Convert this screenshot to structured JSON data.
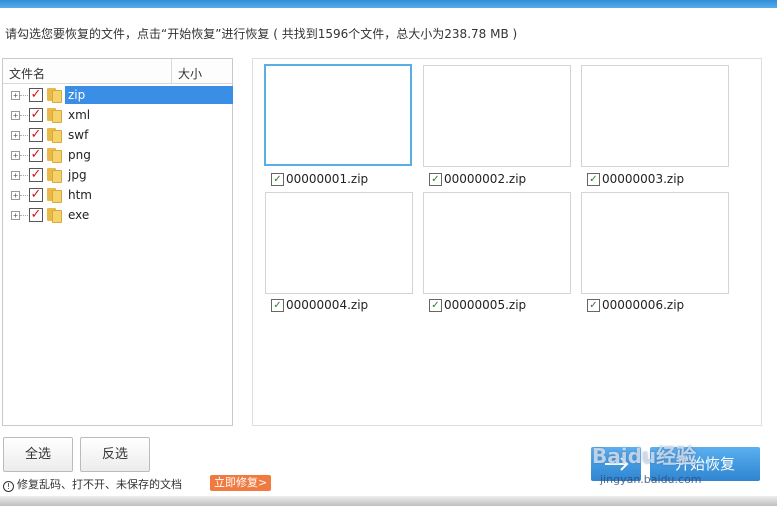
{
  "instruction": "请勾选您要恢复的文件，点击“开始恢复”进行恢复 ( 共找到1596个文件，总大小为238.78 MB )",
  "tree": {
    "col_name": "文件名",
    "col_size": "大小",
    "items": [
      {
        "label": "zip",
        "checked": true,
        "selected": true
      },
      {
        "label": "xml",
        "checked": true,
        "selected": false
      },
      {
        "label": "swf",
        "checked": true,
        "selected": false
      },
      {
        "label": "png",
        "checked": true,
        "selected": false
      },
      {
        "label": "jpg",
        "checked": true,
        "selected": false
      },
      {
        "label": "htm",
        "checked": true,
        "selected": false
      },
      {
        "label": "exe",
        "checked": true,
        "selected": false
      }
    ]
  },
  "files": [
    {
      "name": "00000001.zip",
      "checked": true
    },
    {
      "name": "00000002.zip",
      "checked": true
    },
    {
      "name": "00000003.zip",
      "checked": true
    },
    {
      "name": "00000004.zip",
      "checked": true
    },
    {
      "name": "00000005.zip",
      "checked": true
    },
    {
      "name": "00000006.zip",
      "checked": true
    }
  ],
  "buttons": {
    "select_all": "全选",
    "invert": "反选",
    "start_recovery": "开始恢复"
  },
  "hint": {
    "text": "修复乱码、打不开、未保存的文档",
    "fix_link": "立即修复>"
  },
  "watermark": {
    "logo": "Baidu经验",
    "url": "jingyan.baidu.com"
  },
  "colors": {
    "accent": "#3a8ee6",
    "checkbox_red": "#d4131a",
    "fix_badge": "#f07a3f"
  }
}
